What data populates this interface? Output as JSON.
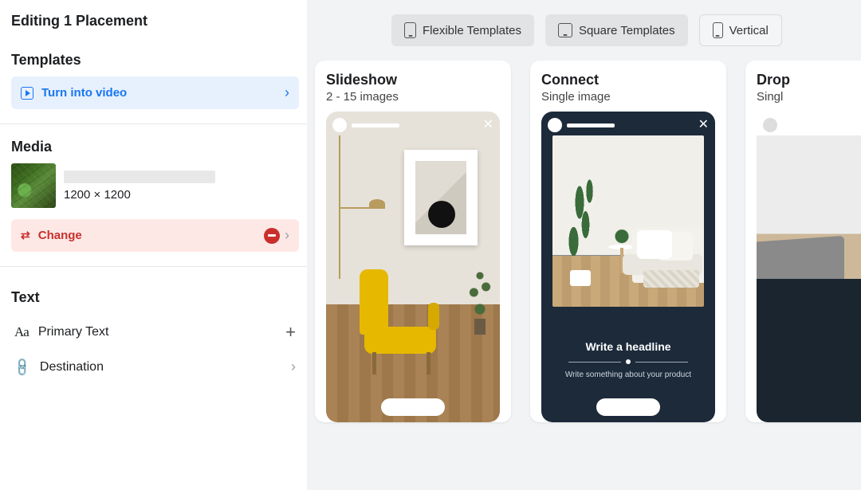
{
  "page_title": "Editing 1 Placement",
  "sidebar": {
    "templates": {
      "heading": "Templates",
      "turn_video_label": "Turn into video"
    },
    "media": {
      "heading": "Media",
      "dimensions": "1200 × 1200",
      "change_label": "Change"
    },
    "text": {
      "heading": "Text",
      "primary_label": "Primary Text",
      "destination_label": "Destination"
    }
  },
  "filters": {
    "flexible": "Flexible Templates",
    "square": "Square Templates",
    "vertical": "Vertical"
  },
  "cards": [
    {
      "title": "Slideshow",
      "subtitle": "2 - 15 images"
    },
    {
      "title": "Connect",
      "subtitle": "Single image",
      "headline": "Write a headline",
      "subline": "Write something about your product"
    },
    {
      "title": "Drop",
      "subtitle": "Singl"
    }
  ]
}
